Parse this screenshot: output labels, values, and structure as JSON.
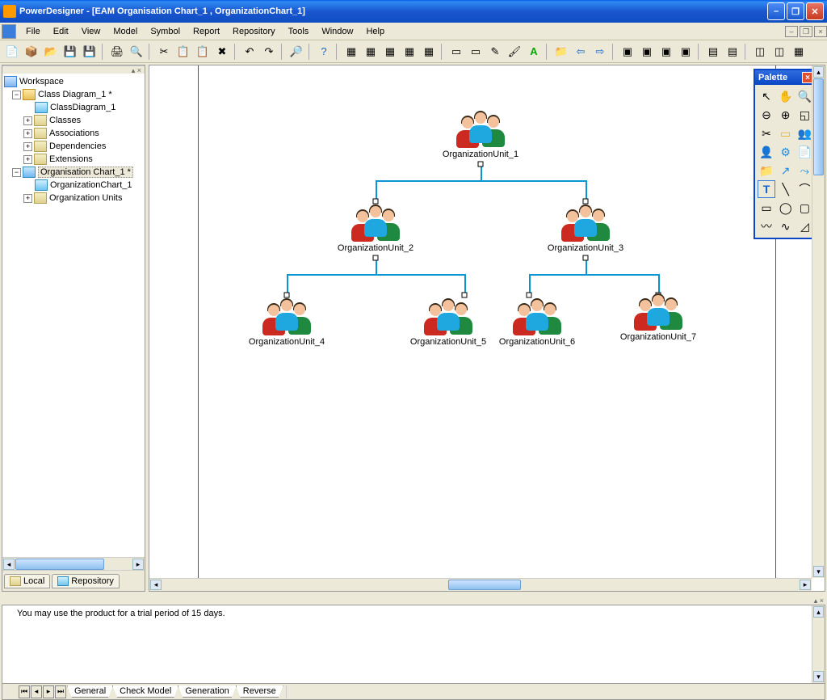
{
  "title": "PowerDesigner - [EAM Organisation Chart_1 , OrganizationChart_1]",
  "menu": [
    "File",
    "Edit",
    "View",
    "Model",
    "Symbol",
    "Report",
    "Repository",
    "Tools",
    "Window",
    "Help"
  ],
  "tree": {
    "root": "Workspace",
    "n1": "Class Diagram_1 *",
    "n1_1": "ClassDiagram_1",
    "n1_2": "Classes",
    "n1_3": "Associations",
    "n1_4": "Dependencies",
    "n1_5": "Extensions",
    "n2": "Organisation Chart_1 *",
    "n2_1": "OrganizationChart_1",
    "n2_2": "Organization Units"
  },
  "sidebar_tabs": {
    "t1": "Local",
    "t2": "Repository"
  },
  "nodes": {
    "u1": "OrganizationUnit_1",
    "u2": "OrganizationUnit_2",
    "u3": "OrganizationUnit_3",
    "u4": "OrganizationUnit_4",
    "u5": "OrganizationUnit_5",
    "u6": "OrganizationUnit_6",
    "u7": "OrganizationUnit_7"
  },
  "palette_title": "Palette",
  "message": "You may use the product for a trial period of 15 days.",
  "bottom_tabs": [
    "General",
    "Check Model",
    "Generation",
    "Reverse"
  ]
}
